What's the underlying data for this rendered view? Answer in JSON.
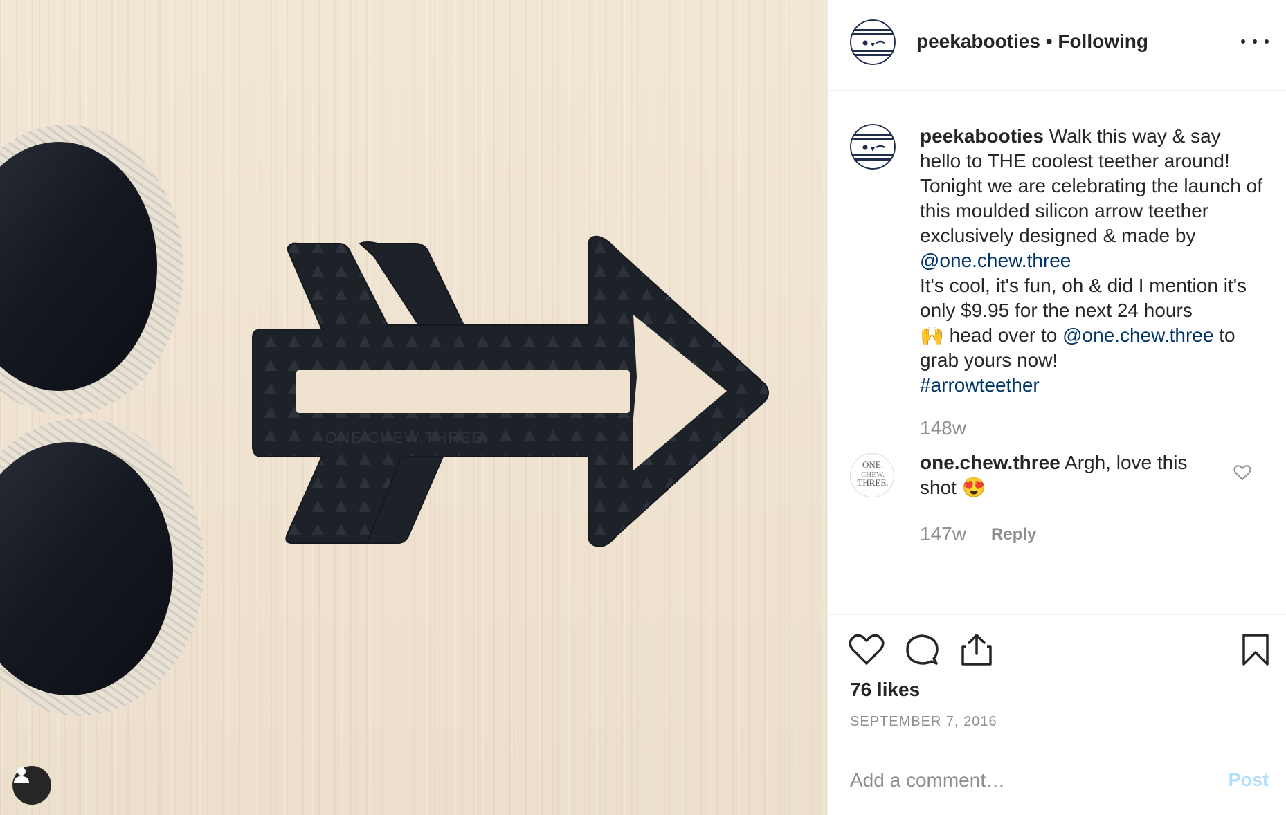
{
  "post_image": {
    "alt_icon": "arrow-teether",
    "teether_text": "ONE.CHEW.THREE.",
    "user_tag_icon": "person-icon"
  },
  "header": {
    "username": "peekabooties",
    "separator": "•",
    "follow_status": "Following",
    "more_icon": "ellipsis-icon"
  },
  "caption": {
    "username": "peekabooties",
    "line1": " Walk this way & say hello to THE coolest teether around! Tonight we are celebrating the launch of this moulded silicon arrow teether exclusively designed & made by ",
    "mention1": "@one.chew.three",
    "line2": "It's cool, it's fun, oh & did I mention it's only $9.95 for the next 24 hours",
    "emoji": "🙌",
    "line3": "  head over to ",
    "mention2": "@one.chew.three",
    "line4": " to grab yours now!",
    "hashtag": "#arrowteether",
    "time": "148w"
  },
  "comment": {
    "avatar_text": [
      "ONE.",
      "CHEW.",
      "THREE."
    ],
    "username": "one.chew.three",
    "text": " Argh, love this shot ",
    "emoji": "😍",
    "time": "147w",
    "reply_label": "Reply"
  },
  "actions": {
    "like_icon": "heart-icon",
    "comment_icon": "comment-bubble-icon",
    "share_icon": "share-icon",
    "save_icon": "bookmark-icon",
    "likes": "76 likes",
    "date": "SEPTEMBER 7, 2016"
  },
  "add_comment": {
    "placeholder": "Add a comment…",
    "post_label": "Post"
  },
  "colors": {
    "link": "#003569",
    "muted": "#8e8e8e",
    "post_disabled": "#b2dffc",
    "owl_navy": "#1f2d4d"
  }
}
